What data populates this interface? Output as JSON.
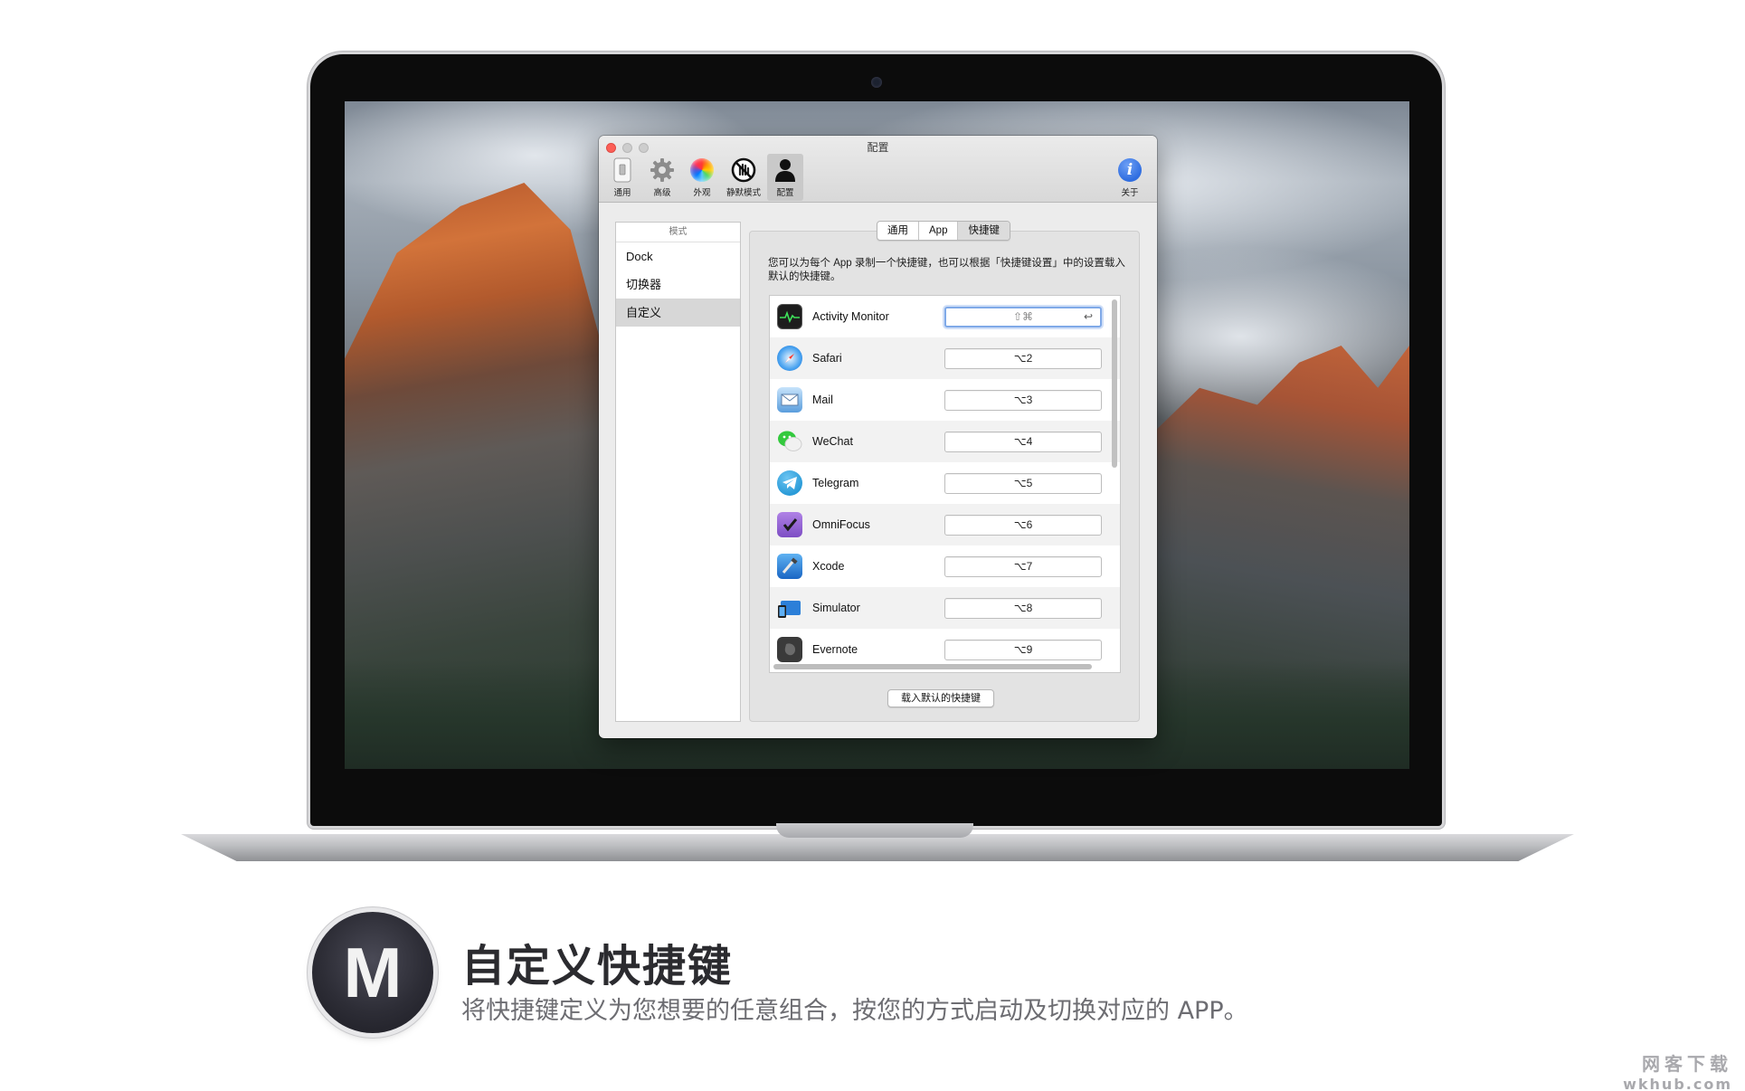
{
  "window": {
    "title": "配置"
  },
  "toolbar": {
    "items": [
      {
        "label": "通用",
        "icon": "switch-icon"
      },
      {
        "label": "高级",
        "icon": "gear-icon"
      },
      {
        "label": "外观",
        "icon": "color-wheel-icon"
      },
      {
        "label": "静默模式",
        "icon": "no-hand-icon"
      },
      {
        "label": "配置",
        "icon": "person-icon",
        "active": true
      }
    ],
    "about_label": "关于"
  },
  "sidebar": {
    "header": "模式",
    "items": [
      {
        "label": "Dock"
      },
      {
        "label": "切换器"
      },
      {
        "label": "自定义",
        "selected": true
      }
    ]
  },
  "tabs": [
    {
      "label": "通用"
    },
    {
      "label": "App"
    },
    {
      "label": "快捷键",
      "active": true
    }
  ],
  "description": "您可以为每个 App 录制一个快捷键，也可以根据「快捷键设置」中的设置载入默认的快捷键。",
  "apps": [
    {
      "name": "Activity Monitor",
      "shortcut": "⇧⌘",
      "focused": true
    },
    {
      "name": "Safari",
      "shortcut": "⌥2"
    },
    {
      "name": "Mail",
      "shortcut": "⌥3"
    },
    {
      "name": "WeChat",
      "shortcut": "⌥4"
    },
    {
      "name": "Telegram",
      "shortcut": "⌥5"
    },
    {
      "name": "OmniFocus",
      "shortcut": "⌥6"
    },
    {
      "name": "Xcode",
      "shortcut": "⌥7"
    },
    {
      "name": "Simulator",
      "shortcut": "⌥8"
    },
    {
      "name": "Evernote",
      "shortcut": "⌥9"
    }
  ],
  "load_default_button": "载入默认的快捷键",
  "enter_glyph": "↩",
  "caption": {
    "logo_letter": "M",
    "headline": "自定义快捷键",
    "subline": "将快捷键定义为您想要的任意组合，按您的方式启动及切换对应的 APP。"
  },
  "watermark": {
    "top": "网客下载",
    "bottom": "wkhub.com"
  },
  "colors": {
    "close_button": "#fc5f57",
    "focus_ring": "#7fa9e8",
    "about_icon": "#2f6de0"
  }
}
